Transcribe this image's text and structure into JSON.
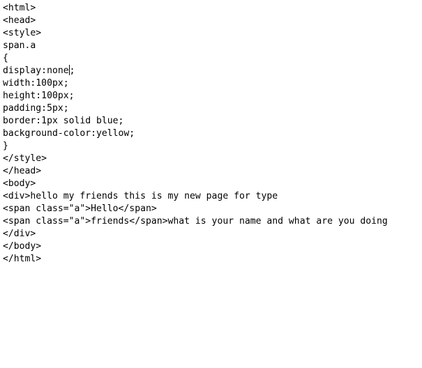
{
  "editor": {
    "caret_line_index": 6,
    "caret_after_text": "display:none",
    "lines": [
      "<html>",
      "<head>",
      "<style>",
      "span.a",
      "{",
      "display:none;",
      "width:100px;",
      "height:100px;",
      "padding:5px;",
      "border:1px solid blue;",
      "background-color:yellow;",
      "}",
      "</style>",
      "</head>",
      "<body>",
      "<div>hello my friends this is my new page for type",
      "<span class=\"a\">Hello</span>",
      "<span class=\"a\">friends</span>what is your name and what are you doing",
      "</div>",
      "</body>",
      "</html>"
    ]
  }
}
